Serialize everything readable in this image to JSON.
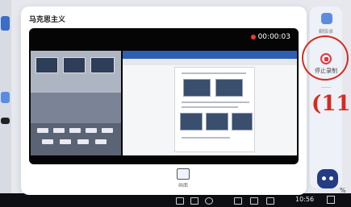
{
  "dialog": {
    "title": "马克思主义"
  },
  "video": {
    "recording_time": "00:00:03"
  },
  "bottom_tool": {
    "label": "画面",
    "icon": "screen-icon"
  },
  "sidebar": {
    "top_label": "翻版录",
    "stop_record_label": "停止录制",
    "stop_icon": "stop-record-icon"
  },
  "annotation": {
    "number": "11"
  },
  "taskbar": {
    "time": "10:56"
  },
  "misc": {
    "battery_percent_fragment": "%"
  },
  "colors": {
    "accent_red": "#d52a1f",
    "record_red": "#f0393c",
    "sidebar_bg": "#eef1f7"
  }
}
